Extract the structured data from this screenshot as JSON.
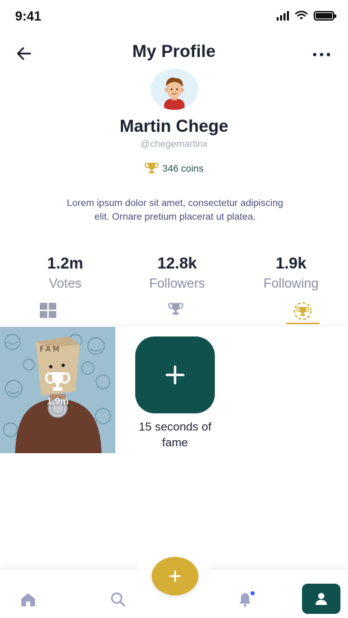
{
  "status_bar": {
    "time": "9:41"
  },
  "header": {
    "title": "My Profile",
    "back_icon": "arrow-left-icon",
    "more_icon": "more-horizontal-icon"
  },
  "profile": {
    "name": "Martin Chege",
    "handle": "@chegemartinx",
    "coins": "346 coins",
    "bio": "Lorem ipsum dolor sit amet, consectetur adipiscing elit. Ornare pretium placerat ut platea."
  },
  "stats": [
    {
      "value": "1.2m",
      "label": "Votes"
    },
    {
      "value": "12.8k",
      "label": "Followers"
    },
    {
      "value": "1.9k",
      "label": "Following"
    }
  ],
  "tabs": [
    {
      "icon": "grid-icon",
      "active": false
    },
    {
      "icon": "trophy-icon",
      "active": false
    },
    {
      "icon": "trophy-badge-icon",
      "active": true
    }
  ],
  "posts": [
    {
      "count": "1.9m",
      "icon": "trophy-icon"
    }
  ],
  "add_post": {
    "caption": "15 seconds of fame",
    "icon": "plus-icon"
  },
  "bottom_nav": {
    "items": [
      "home-icon",
      "search-icon",
      "bell-icon",
      "user-icon"
    ],
    "fab_icon": "plus-icon",
    "active": "user-icon"
  },
  "colors": {
    "primary": "#10514d",
    "accent": "#d4ae35",
    "text": "#1c2130",
    "muted": "#8a8fa3",
    "bio": "#4a4e78",
    "notification": "#2d63f0"
  }
}
